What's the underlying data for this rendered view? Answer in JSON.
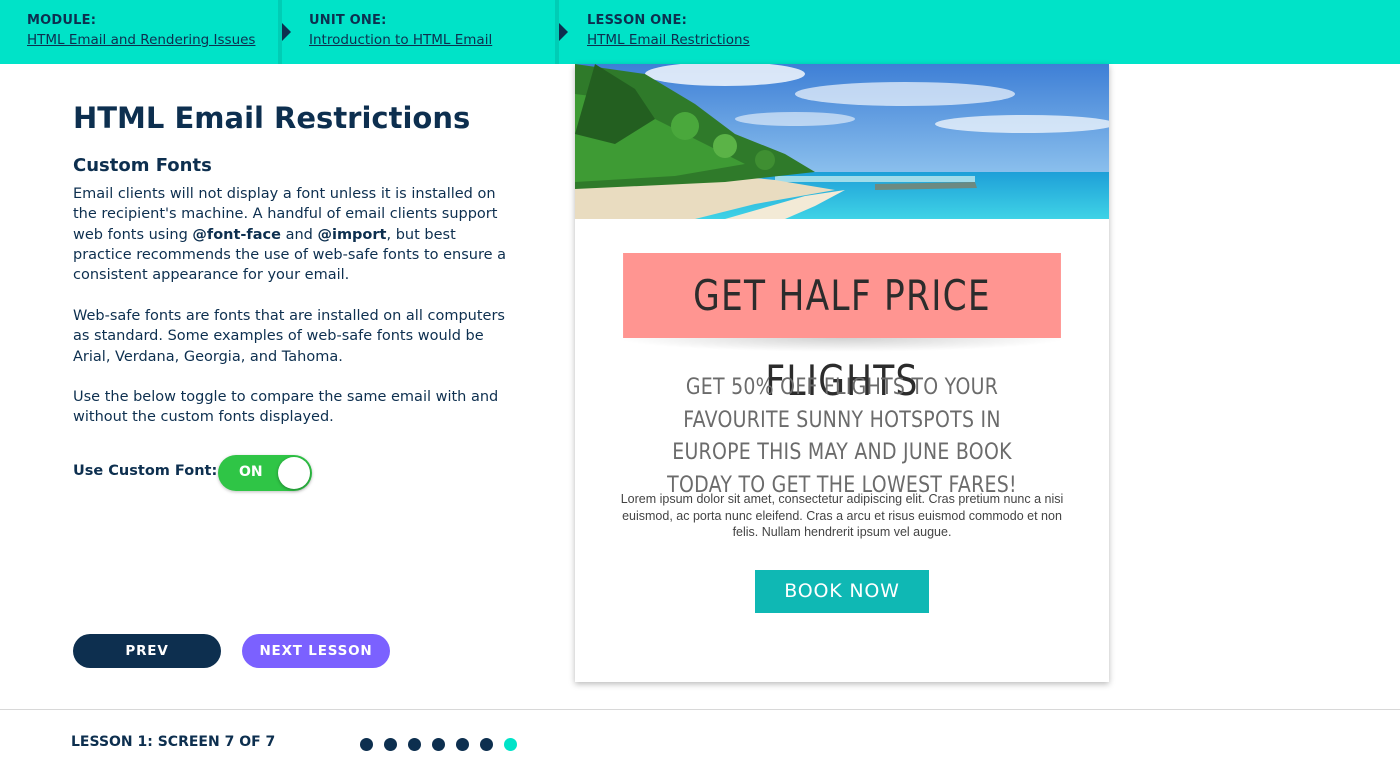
{
  "breadcrumbs": [
    {
      "key": "MODULE:",
      "value": "HTML Email and Rendering Issues"
    },
    {
      "key": "UNIT ONE:",
      "value": "Introduction to HTML Email"
    },
    {
      "key": "LESSON ONE:",
      "value": "HTML Email Restrictions"
    }
  ],
  "content": {
    "title": "HTML Email Restrictions",
    "subtitle": "Custom Fonts",
    "p1_part1": "Email clients will not display a font unless it is installed on the recipient's machine. A handful of email clients support web fonts using ",
    "p1_bold1": "@font-face",
    "p1_part2": " and ",
    "p1_bold2": "@import",
    "p1_part3": ", but best practice recommends the use of web-safe fonts to ensure a consistent appearance for your email.",
    "p2": "Web-safe fonts are fonts that are installed on all computers as standard. Some examples of web-safe fonts would be Arial, Verdana, Georgia, and Tahoma.",
    "p3": "Use the below toggle to compare the same email with and without the custom fonts displayed.",
    "toggle_label": "Use Custom Font:",
    "toggle_state": "ON"
  },
  "nav": {
    "prev": "PREV",
    "next": "NEXT LESSON"
  },
  "email": {
    "banner": "GET HALF PRICE FLIGHTS",
    "offer": "GET 50% OFF FLIGHTS TO YOUR FAVOURITE SUNNY HOTSPOTS IN EUROPE THIS MAY AND JUNE BOOK TODAY TO GET THE LOWEST FARES!",
    "lorem": "Lorem ipsum dolor sit amet, consectetur adipiscing elit. Cras pretium nunc a nisi euismod, ac porta nunc eleifend. Cras a arcu et risus euismod commodo et non felis. Nullam hendrerit ipsum vel augue.",
    "cta": "BOOK NOW"
  },
  "footer": {
    "screen_count": "LESSON 1: SCREEN 7 OF 7",
    "total_screens": 7,
    "current_screen": 7
  },
  "colors": {
    "teal_bar": "#00e3c8",
    "navy": "#0d2f4f",
    "toggle_green": "#2fc546",
    "next_purple": "#7b61ff",
    "banner_pink": "#ff9591",
    "cta_teal": "#0fb8b4"
  }
}
